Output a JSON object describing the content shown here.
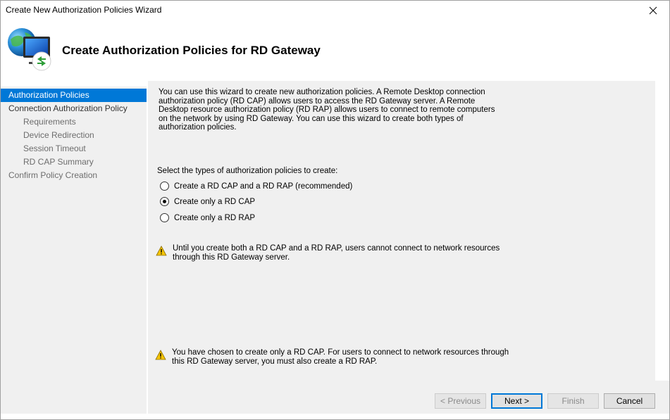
{
  "window": {
    "title": "Create New Authorization Policies Wizard"
  },
  "header": {
    "heading": "Create Authorization Policies for RD Gateway"
  },
  "sidebar": {
    "items": [
      {
        "label": "Authorization Policies",
        "state": "active"
      },
      {
        "label": "Connection Authorization Policy",
        "state": "normal"
      },
      {
        "label": "Requirements",
        "state": "sub"
      },
      {
        "label": "Device Redirection",
        "state": "sub"
      },
      {
        "label": "Session Timeout",
        "state": "sub"
      },
      {
        "label": "RD CAP Summary",
        "state": "sub"
      },
      {
        "label": "Confirm Policy Creation",
        "state": "dim"
      }
    ]
  },
  "main": {
    "intro_lines": [
      "You can use this wizard to create new authorization policies. A Remote Desktop connection",
      "authorization policy (RD CAP) allows users to access the RD Gateway server. A Remote",
      "Desktop resource authorization policy (RD RAP) allows users to connect to remote computers",
      "on the network by using RD Gateway. You can use this wizard to create both types of",
      "authorization policies."
    ],
    "select_label": "Select the types of authorization policies to create:",
    "options": [
      {
        "label": "Create a RD CAP and a RD RAP (recommended)",
        "checked": false
      },
      {
        "label": "Create only a RD CAP",
        "checked": true
      },
      {
        "label": "Create only a RD RAP",
        "checked": false
      }
    ],
    "warning_1": [
      "Until you create both a RD CAP and a RD RAP, users cannot connect to network resources",
      "through this RD Gateway server."
    ],
    "warning_2": [
      "You have chosen to create only a RD CAP. For users to connect to network resources through",
      "this RD Gateway server, you must also create a RD RAP."
    ]
  },
  "footer": {
    "previous": "< Previous",
    "next": "Next >",
    "finish": "Finish",
    "cancel": "Cancel"
  },
  "colors": {
    "accent": "#0078d7",
    "panel": "#f0f0f0",
    "warning": "#f5c400"
  }
}
